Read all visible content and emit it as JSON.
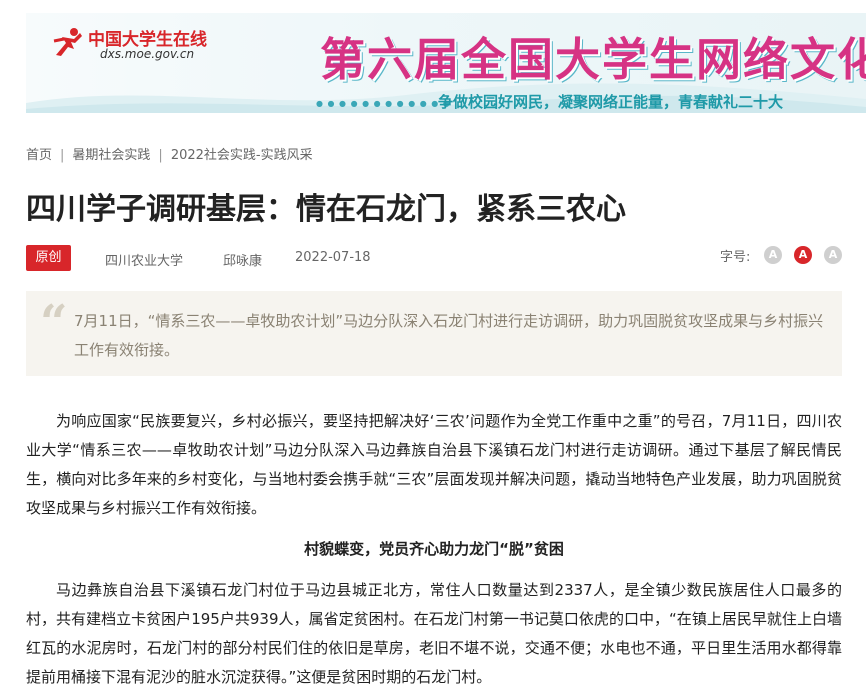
{
  "banner": {
    "logo_title": "中国大学生在线",
    "logo_url": "dxs.moe.gov.cn",
    "headline": "第六届全国大学生网络文化",
    "slogan": "争做校园好网民，凝聚网络正能量，青春献礼二十大",
    "colors": {
      "headline": "#d63384",
      "slogan": "#1f9aa8",
      "logo": "#d8262a"
    }
  },
  "breadcrumb": {
    "items": [
      "首页",
      "暑期社会实践",
      "2022社会实践-实践风采"
    ],
    "separator": "|"
  },
  "article": {
    "title": "四川学子调研基层：情在石龙门，紧系三农心",
    "badge": "原创",
    "school": "四川农业大学",
    "author": "邱咏康",
    "date": "2022-07-18",
    "fontsize_label": "字号:",
    "fontsize_options": [
      "A",
      "A",
      "A"
    ],
    "fontsize_selected": 1,
    "summary": "7月11日，“情系三农——卓牧助农计划”马边分队深入石龙门村进行走访调研，助力巩固脱贫攻坚成果与乡村振兴工作有效衔接。",
    "paragraph1": "为响应国家“民族要复兴，乡村必振兴，要坚持把解决好‘三农’问题作为全党工作重中之重”的号召，7月11日，四川农业大学“情系三农——卓牧助农计划”马边分队深入马边彝族自治县下溪镇石龙门村进行走访调研。通过下基层了解民情民生，横向对比多年来的乡村变化，与当地村委会携手就“三农”层面发现并解决问题，撬动当地特色产业发展，助力巩固脱贫攻坚成果与乡村振兴工作有效衔接。",
    "subheading": "村貌蝶变，党员齐心助力龙门“脱”贫困",
    "paragraph2": "马边彝族自治县下溪镇石龙门村位于马边县城正北方，常住人口数量达到2337人，是全镇少数民族居住人口最多的村，共有建档立卡贫困户195户共939人，属省定贫困村。在石龙门村第一书记莫口依虎的口中，“在镇上居民早就住上白墙红瓦的水泥房时，石龙门村的部分村民们住的依旧是草房，老旧不堪不说，交通不便；水电也不通，平日里生活用水都得靠提前用桶接下混有泥沙的脏水沉淀获得。”这便是贫困时期的石龙门村。",
    "colors": {
      "accent": "#d8262a",
      "summary_bg": "#f6f4ef"
    }
  }
}
